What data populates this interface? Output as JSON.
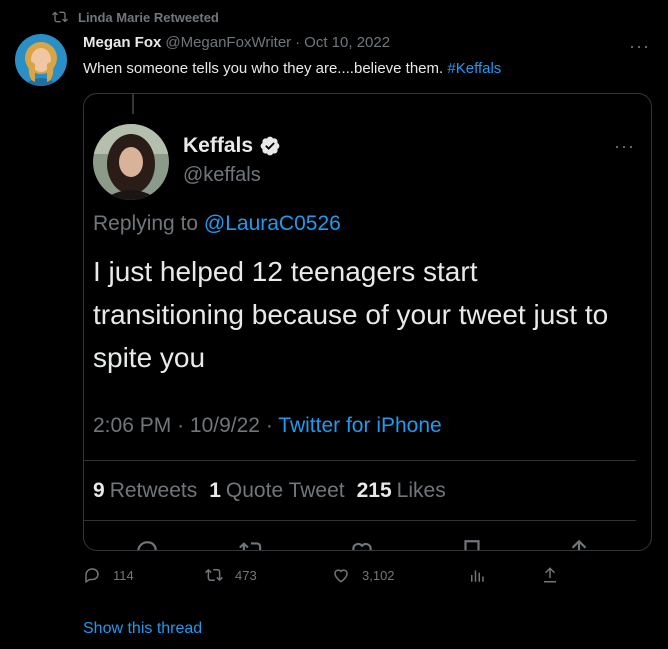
{
  "retweet_header": {
    "text": "Linda Marie Retweeted",
    "icon": "retweet-icon"
  },
  "tweet": {
    "author_name": "Megan Fox",
    "author_handle": "@MeganFoxWriter",
    "separator": "·",
    "date": "Oct 10, 2022",
    "more": "···",
    "text": "When someone tells you who they are....believe them.",
    "hashtag": "#Keffals",
    "actions": {
      "replies": "114",
      "retweets": "473",
      "likes": "3,102"
    },
    "show_thread": "Show this thread"
  },
  "quoted": {
    "name": "Keffals",
    "handle": "@keffals",
    "verified_icon": "verified-badge-icon",
    "more": "···",
    "replying_label": "Replying to",
    "replying_to": "@LauraC0526",
    "text": "I just helped 12 teenagers start transitioning because of your tweet just to spite you",
    "time": "2:06 PM",
    "date": "10/9/22",
    "dot": "·",
    "source": "Twitter for iPhone",
    "stats": {
      "retweets_count": "9",
      "retweets_label": "Retweets",
      "quotes_count": "1",
      "quotes_label": "Quote Tweet",
      "likes_count": "215",
      "likes_label": "Likes"
    }
  },
  "colors": {
    "background": "#000000",
    "text": "#e7e9ea",
    "muted": "#71767b",
    "accent": "#1d9bf0",
    "border": "#333639"
  }
}
